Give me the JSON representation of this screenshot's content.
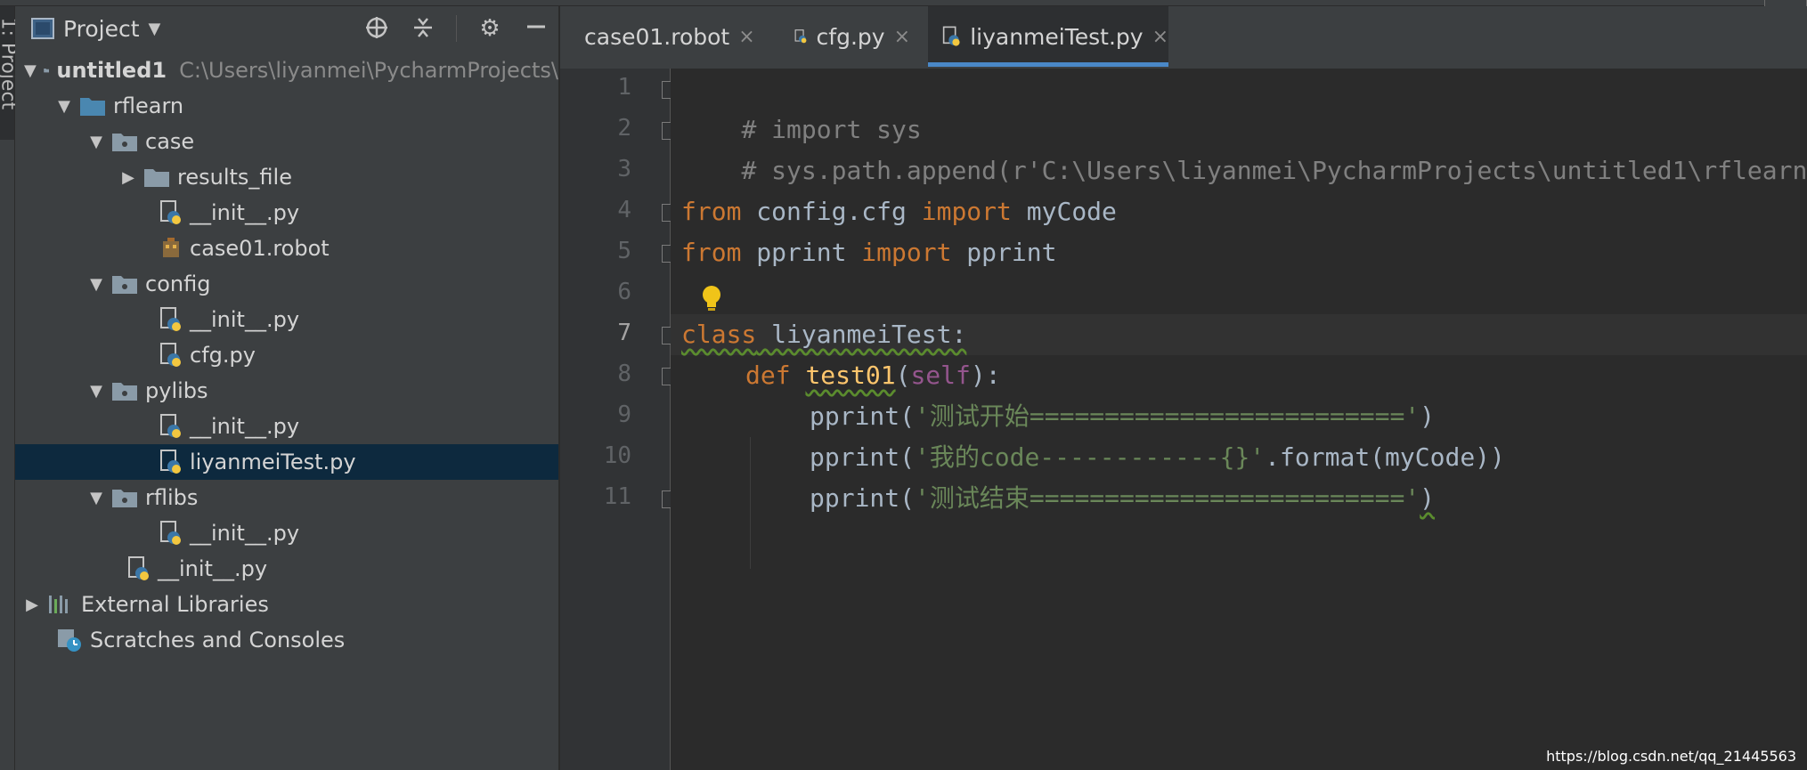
{
  "project_panel": {
    "title": "Project",
    "tool_strip_label": "1: Project",
    "tree": [
      {
        "label": "untitled1",
        "path": "C:\\Users\\liyanmei\\PycharmProjects\\",
        "bold": true
      },
      {
        "label": "rflearn"
      },
      {
        "label": "case"
      },
      {
        "label": "results_file"
      },
      {
        "label": "__init__.py"
      },
      {
        "label": "case01.robot"
      },
      {
        "label": "config"
      },
      {
        "label": "__init__.py"
      },
      {
        "label": "cfg.py"
      },
      {
        "label": "pylibs"
      },
      {
        "label": "__init__.py"
      },
      {
        "label": "liyanmeiTest.py",
        "selected": true
      },
      {
        "label": "rflibs"
      },
      {
        "label": "__init__.py"
      },
      {
        "label": "__init__.py"
      },
      {
        "label": "External Libraries"
      },
      {
        "label": "Scratches and Consoles"
      }
    ]
  },
  "editor": {
    "tabs": [
      {
        "label": "case01.robot",
        "close": "×"
      },
      {
        "label": "cfg.py",
        "close": "×"
      },
      {
        "label": "liyanmeiTest.py",
        "close": "×",
        "active": true
      }
    ],
    "line_numbers": [
      "1",
      "2",
      "3",
      "4",
      "5",
      "6",
      "7",
      "8",
      "9",
      "10",
      "11"
    ],
    "code": {
      "l1": "# import sys",
      "l2": "# sys.path.append(r'C:\\Users\\liyanmei\\PycharmProjects\\untitled1\\rflearn",
      "l4_kw1": "from",
      "l4_mid": " config.cfg ",
      "l4_kw2": "import",
      "l4_end": " myCode",
      "l5_kw1": "from",
      "l5_mid": " pprint ",
      "l5_kw2": "import",
      "l5_end": " pprint",
      "l7_kw": "class",
      "l7_name": " liyanmeiTest:",
      "l8_kw": "def",
      "l8_fn": "test01",
      "l8_open": "(",
      "l8_self": "self",
      "l8_close": "):",
      "l9_call": "pprint(",
      "l9_str": "'测试开始========================='",
      "l9_end": ")",
      "l10_call": "pprint(",
      "l10_str": "'我的code------------{}'",
      "l10_end": ".format(myCode))",
      "l11_call": "pprint(",
      "l11_str": "'测试结束========================='",
      "l11_end": ")"
    }
  },
  "watermark": "https://blog.csdn.net/qq_21445563",
  "colors": {
    "selection": "#0d293e",
    "keyword": "#cc7832",
    "string": "#6a8759",
    "tab_underline": "#4a88c7",
    "red_mark": "#e8232a"
  }
}
